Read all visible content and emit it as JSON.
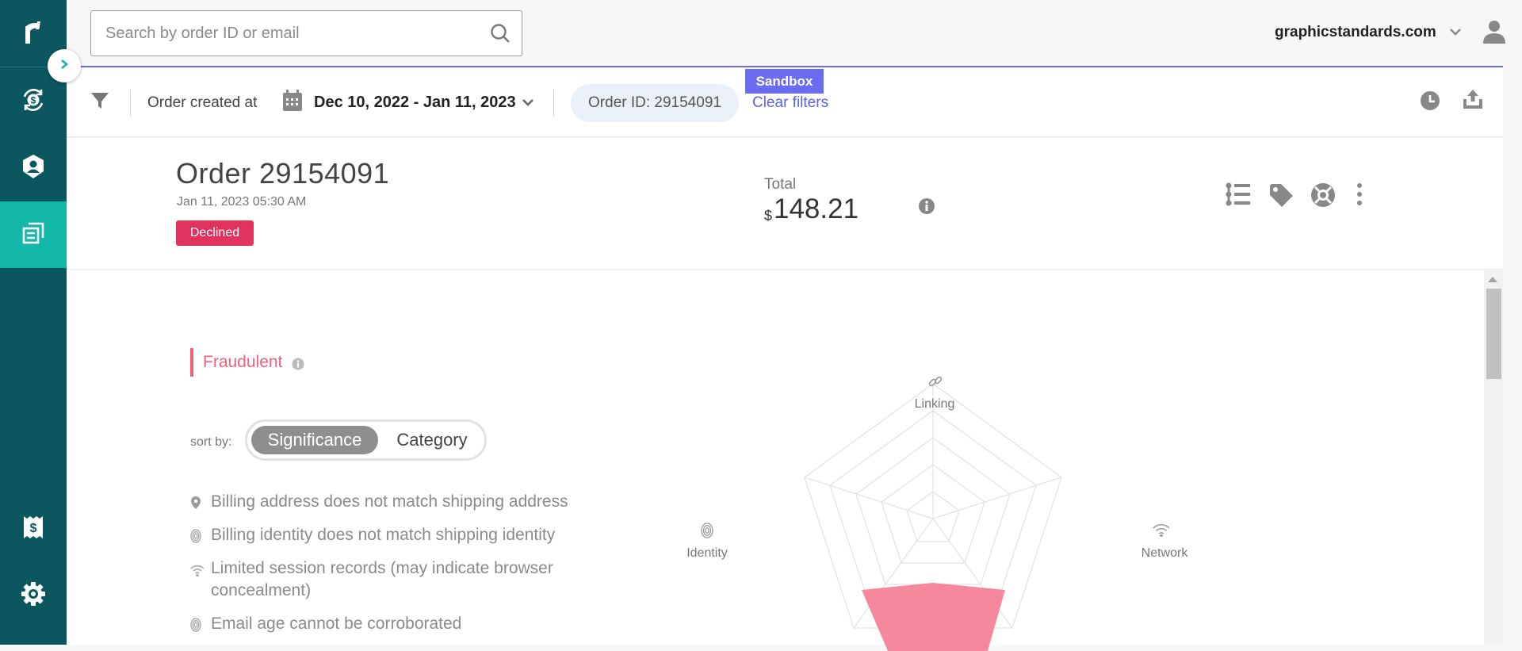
{
  "sidebar": {
    "logo": "r-logo",
    "items": [
      {
        "name": "payments",
        "icon": "dollar-cycle-icon"
      },
      {
        "name": "identity",
        "icon": "user-shield-icon"
      },
      {
        "name": "orders",
        "icon": "document-list-icon",
        "active": true
      },
      {
        "name": "billing",
        "icon": "receipt-dollar-icon"
      },
      {
        "name": "settings",
        "icon": "gear-icon"
      }
    ]
  },
  "search": {
    "placeholder": "Search by order ID or email"
  },
  "account": {
    "domain": "graphicstandards.com"
  },
  "filters": {
    "sandbox": "Sandbox",
    "created_label": "Order created at",
    "date_range": "Dec 10, 2022 - Jan 11, 2023",
    "order_chip": "Order ID: 29154091",
    "clear": "Clear filters"
  },
  "order": {
    "title": "Order 29154091",
    "date": "Jan 11, 2023 05:30 AM",
    "status": "Declined",
    "total_label": "Total",
    "currency": "$",
    "total": "148.21"
  },
  "analysis": {
    "verdict": "Fraudulent",
    "sort_label": "sort by:",
    "sort_options": [
      "Significance",
      "Category"
    ],
    "reasons": [
      {
        "icon": "map-pin-icon",
        "text": "Billing address does not match shipping address"
      },
      {
        "icon": "fingerprint-icon",
        "text": "Billing identity does not match shipping identity"
      },
      {
        "icon": "wifi-icon",
        "text": "Limited session records (may indicate browser concealment)"
      },
      {
        "icon": "fingerprint-icon",
        "text": "Email age cannot be corroborated"
      }
    ],
    "radar_axes": [
      "Linking",
      "Network",
      "Identity"
    ]
  },
  "colors": {
    "sidebar": "#0b565f",
    "sidebar_active": "#14b8a8",
    "accent": "#6b6cf0",
    "declined": "#e0335e",
    "fraud": "#f0607b",
    "radar_fill": "#f47b92"
  }
}
